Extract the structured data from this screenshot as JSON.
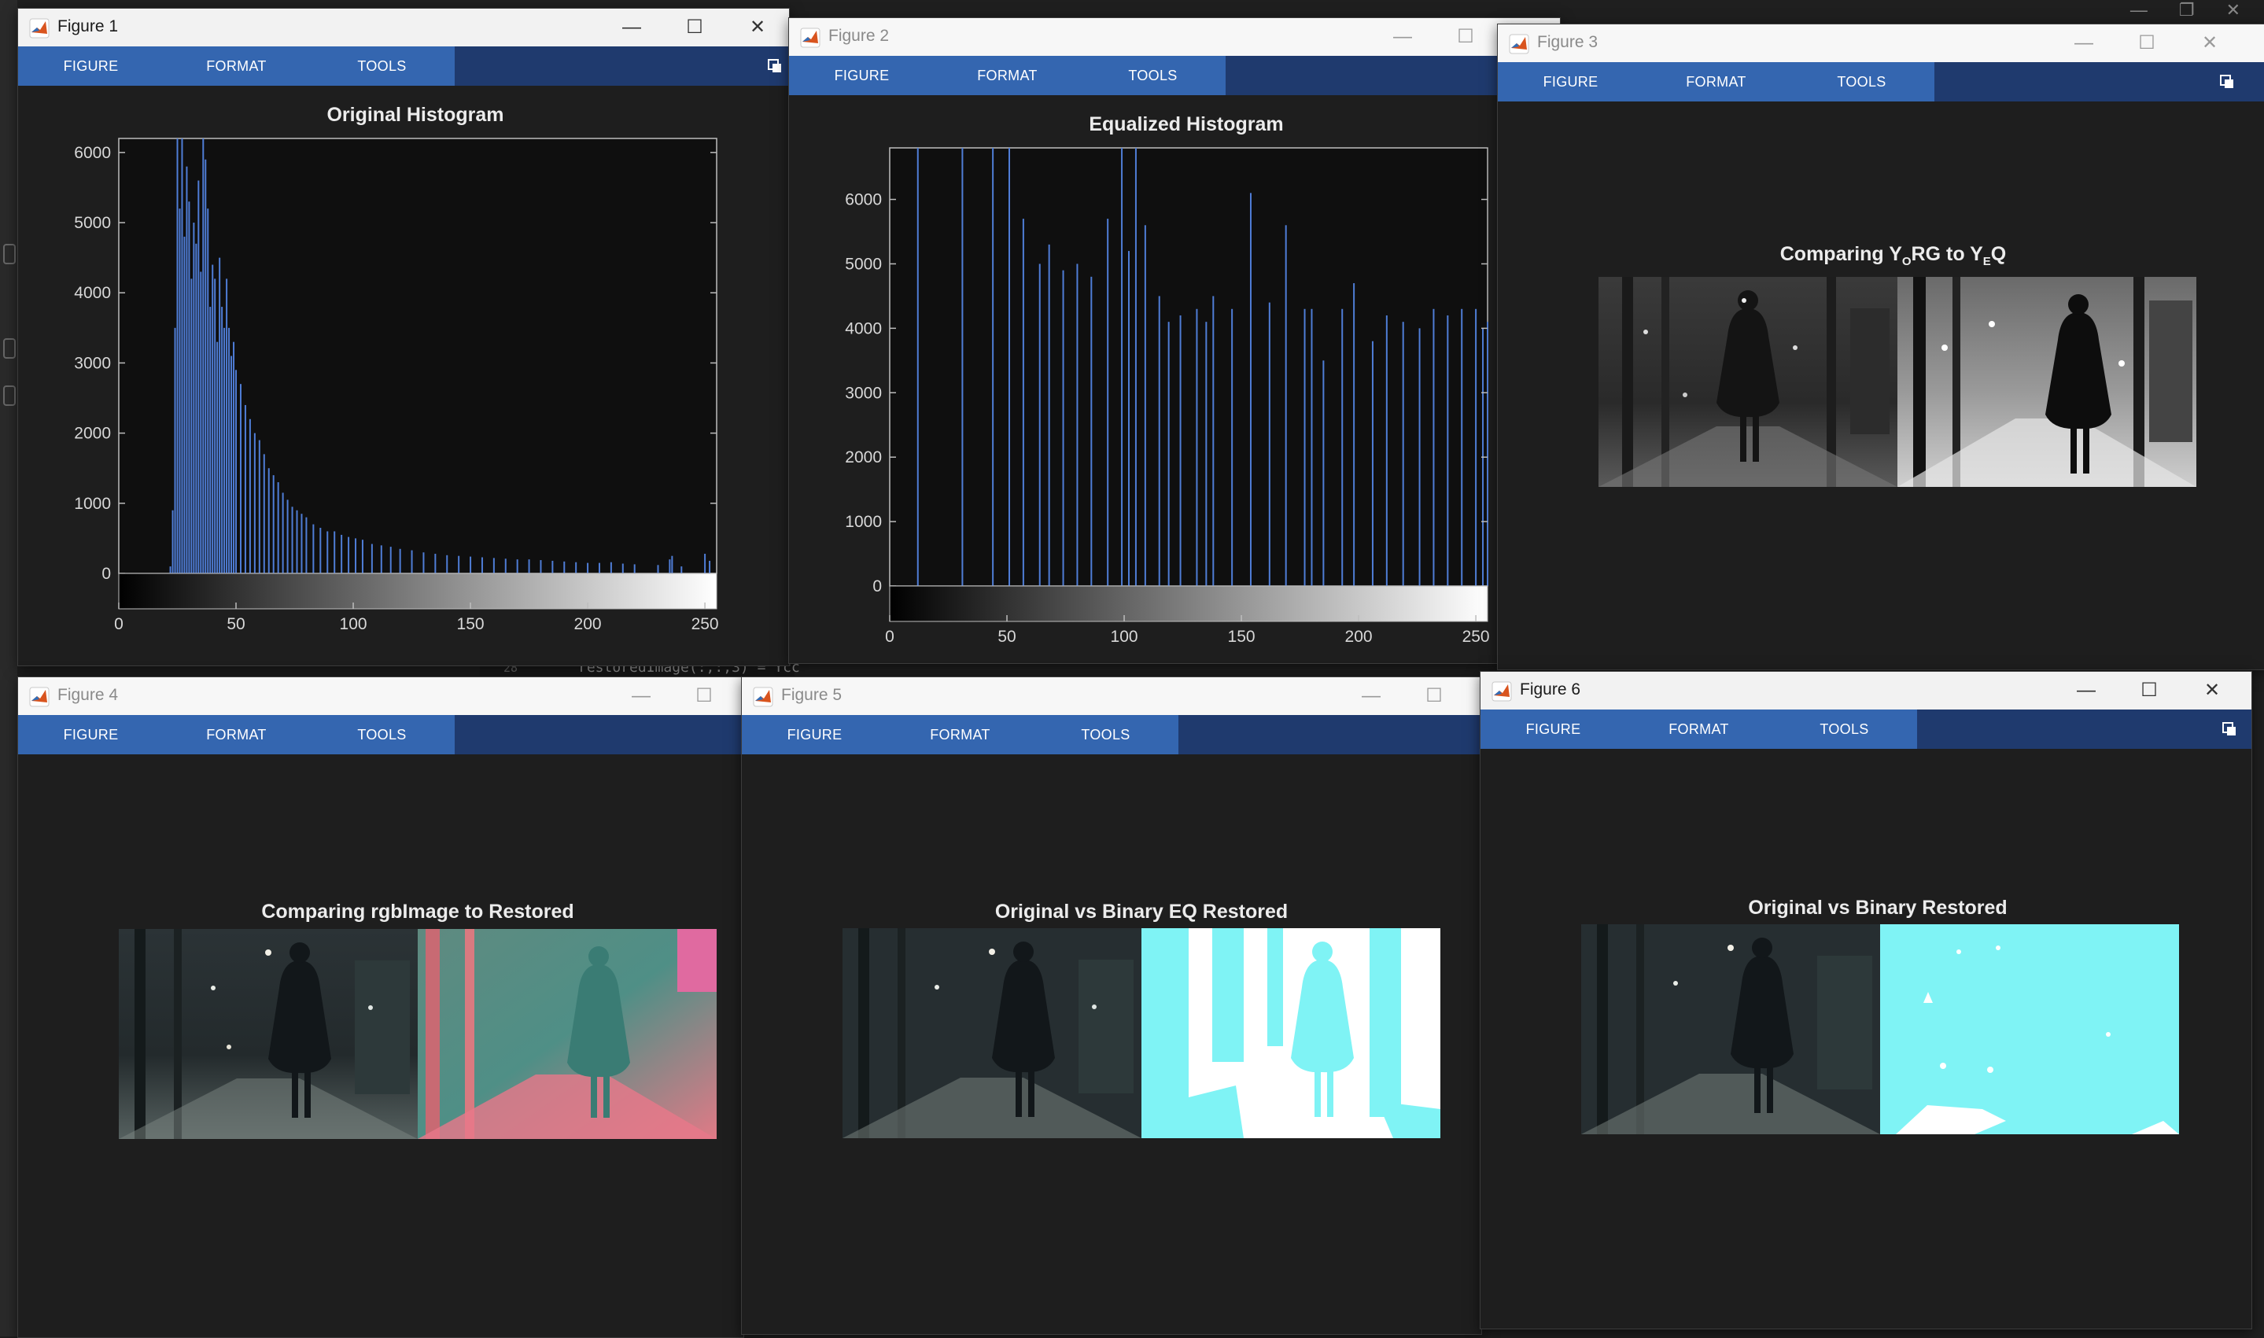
{
  "menu_tabs": [
    "FIGURE",
    "FORMAT",
    "TOOLS"
  ],
  "background_code": {
    "line_number": "28",
    "text": "restoredImage(:,:,3) = Ycc"
  },
  "windows": {
    "fig1": {
      "title": "Figure 1",
      "plot_title": "Original Histogram"
    },
    "fig2": {
      "title": "Figure 2",
      "plot_title": "Equalized Histogram"
    },
    "fig3": {
      "title": "Figure 3",
      "plot_title_parts": [
        "Comparing Y",
        "O",
        "RG to Y",
        "E",
        "Q"
      ]
    },
    "fig4": {
      "title": "Figure 4",
      "plot_title": "Comparing rgbImage to Restored"
    },
    "fig5": {
      "title": "Figure 5",
      "plot_title": "Original vs Binary EQ Restored"
    },
    "fig6": {
      "title": "Figure 6",
      "plot_title": "Original vs Binary Restored"
    }
  },
  "chart_data": [
    {
      "type": "bar",
      "title": "Original Histogram",
      "xlim": [
        0,
        255
      ],
      "ylim": [
        0,
        6200
      ],
      "xticks": [
        0,
        50,
        100,
        150,
        200,
        250
      ],
      "yticks": [
        0,
        1000,
        2000,
        3000,
        4000,
        5000,
        6000
      ],
      "bar_color": "#4f7dd6",
      "colorbar": "grayscale",
      "x": [
        22,
        23,
        24,
        25,
        26,
        27,
        28,
        29,
        30,
        31,
        32,
        33,
        34,
        35,
        36,
        37,
        38,
        39,
        40,
        41,
        42,
        43,
        44,
        45,
        46,
        47,
        48,
        49,
        50,
        52,
        54,
        56,
        58,
        60,
        62,
        64,
        66,
        68,
        70,
        72,
        74,
        76,
        78,
        80,
        83,
        86,
        89,
        92,
        95,
        98,
        101,
        104,
        108,
        112,
        116,
        120,
        125,
        130,
        135,
        140,
        145,
        150,
        155,
        160,
        165,
        170,
        175,
        180,
        185,
        190,
        195,
        200,
        205,
        210,
        215,
        220,
        230,
        235,
        236,
        240,
        250,
        252
      ],
      "values": [
        100,
        900,
        3500,
        6200,
        5200,
        6200,
        4800,
        5800,
        5300,
        4200,
        5000,
        4700,
        5600,
        4300,
        6200,
        5900,
        5200,
        3800,
        4400,
        4200,
        3300,
        4500,
        3800,
        3500,
        4200,
        3500,
        3100,
        3300,
        2900,
        2700,
        2400,
        2200,
        2000,
        1900,
        1700,
        1500,
        1400,
        1300,
        1150,
        1050,
        950,
        900,
        850,
        800,
        700,
        650,
        600,
        600,
        550,
        520,
        500,
        480,
        420,
        400,
        380,
        350,
        330,
        300,
        280,
        260,
        250,
        240,
        230,
        220,
        210,
        200,
        200,
        190,
        180,
        170,
        160,
        150,
        150,
        160,
        140,
        130,
        120,
        200,
        250,
        100,
        280,
        180
      ]
    },
    {
      "type": "bar",
      "title": "Equalized Histogram",
      "xlim": [
        0,
        255
      ],
      "ylim": [
        0,
        6800
      ],
      "xticks": [
        0,
        50,
        100,
        150,
        200,
        250
      ],
      "yticks": [
        0,
        1000,
        2000,
        3000,
        4000,
        5000,
        6000
      ],
      "bar_color": "#4f7dd6",
      "colorbar": "grayscale",
      "x": [
        12,
        31,
        44,
        51,
        57,
        64,
        68,
        74,
        80,
        86,
        93,
        99,
        102,
        105,
        109,
        115,
        119,
        124,
        131,
        135,
        138,
        146,
        154,
        162,
        169,
        177,
        180,
        185,
        193,
        198,
        206,
        212,
        219,
        226,
        232,
        238,
        244,
        250,
        253,
        255
      ],
      "values": [
        6800,
        6800,
        6800,
        6800,
        5700,
        5000,
        5300,
        4900,
        5000,
        4800,
        5700,
        6800,
        5200,
        6800,
        5600,
        4500,
        4100,
        4200,
        4300,
        4100,
        4500,
        4300,
        6100,
        4400,
        5600,
        4300,
        4300,
        3500,
        4300,
        4700,
        3800,
        4200,
        4100,
        4000,
        4300,
        4200,
        4300,
        4300,
        4000,
        4100
      ]
    }
  ]
}
